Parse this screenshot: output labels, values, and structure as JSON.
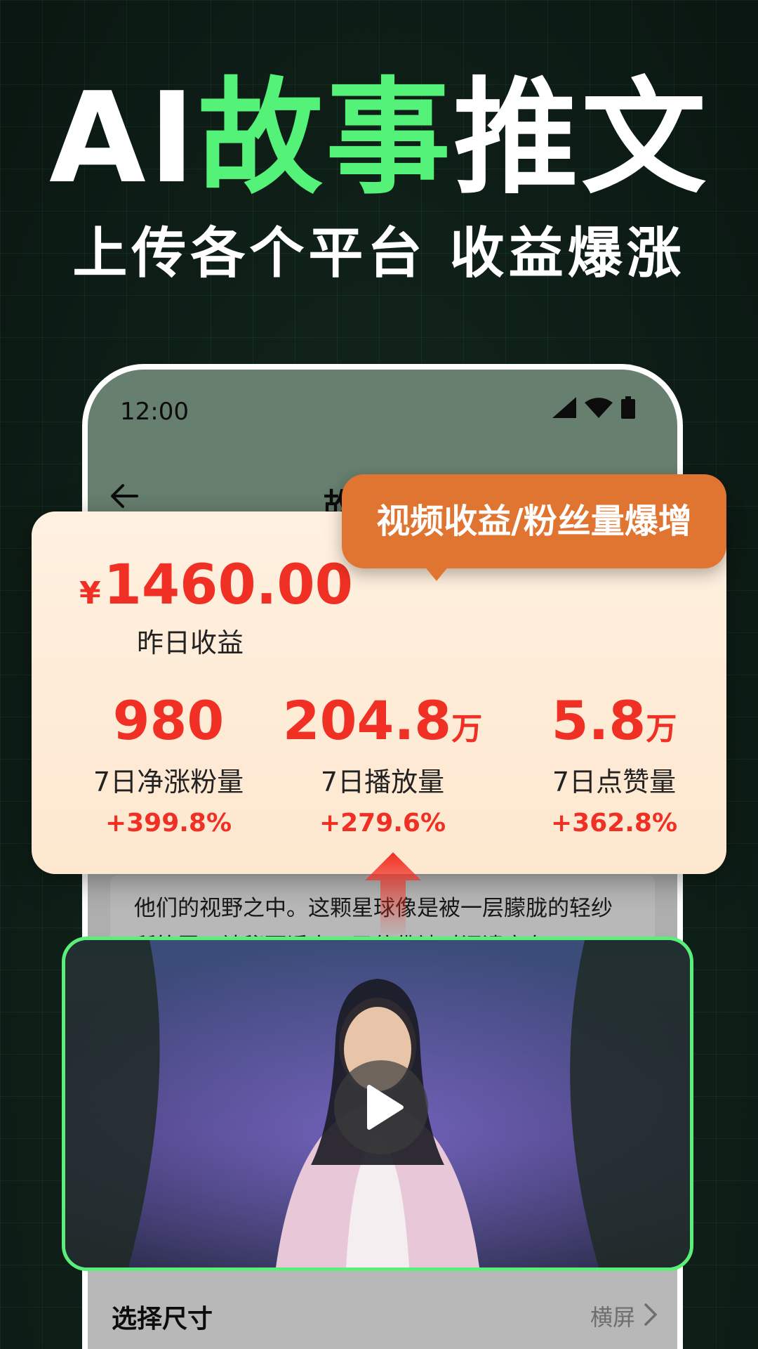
{
  "hero": {
    "title_prefix": "AI",
    "title_highlight": "故事",
    "title_suffix": "推文",
    "subtitle": "上传各个平台 收益爆涨"
  },
  "phone": {
    "status_time": "12:00",
    "app_title": "故事推文",
    "article_text": "他们的视野之中。这颗星球像是被一层朦胧的轻纱所笼罩，神秘而诱人，又仿佛被时间遗忘在",
    "size_label": "选择尺寸",
    "size_value": "横屏"
  },
  "bubble": {
    "text": "视频收益/粉丝量爆增"
  },
  "stats": {
    "currency": "¥",
    "income": "1460.00",
    "income_label": "昨日收益",
    "items": [
      {
        "value": "980",
        "unit": "",
        "label": "7日净涨粉量",
        "change": "+399.8%"
      },
      {
        "value": "204.8",
        "unit": "万",
        "label": "7日播放量",
        "change": "+279.6%"
      },
      {
        "value": "5.8",
        "unit": "万",
        "label": "7日点赞量",
        "change": "+362.8%"
      }
    ]
  },
  "colors": {
    "accent_green": "#55f27a",
    "income_red": "#f03024",
    "bubble_orange": "#e07532",
    "header_green": "#8fb09a"
  },
  "icons": [
    "back-arrow-icon",
    "history-icon",
    "signal-icon",
    "wifi-icon",
    "battery-icon",
    "chevron-right-icon",
    "play-icon",
    "arrow-up-icon"
  ]
}
